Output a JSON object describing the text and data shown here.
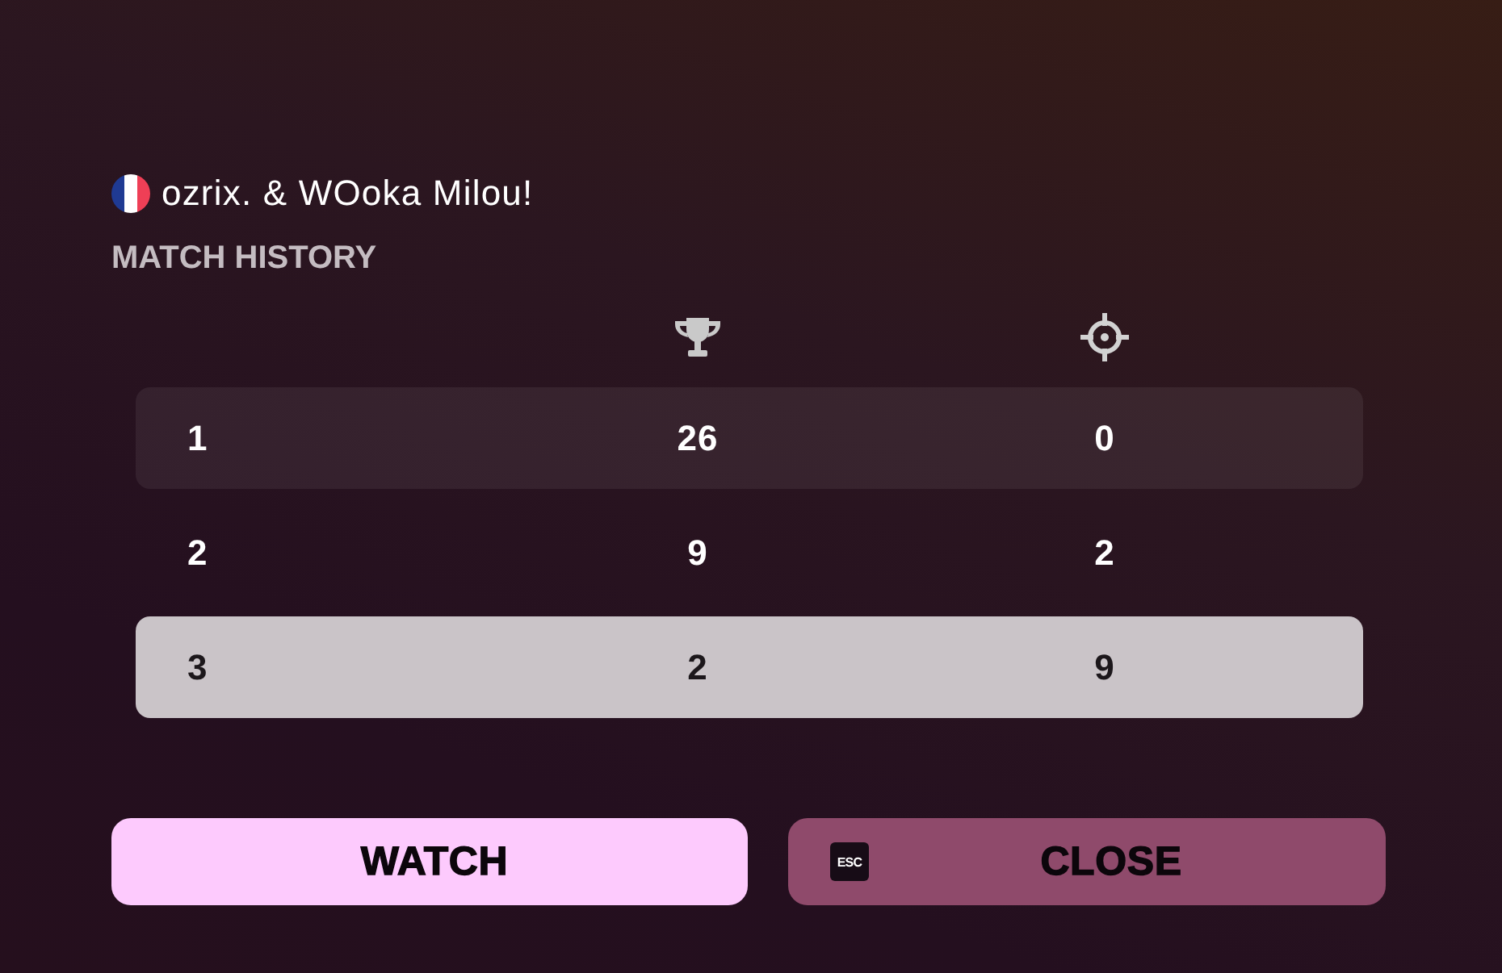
{
  "player": {
    "name": "ozrix. & WOoka Milou!"
  },
  "section_title": "MATCH HISTORY",
  "table": {
    "rows": [
      {
        "cells": [
          "1",
          "26",
          "0"
        ],
        "selected": false
      },
      {
        "cells": [
          "2",
          "9",
          "2"
        ],
        "selected": false
      },
      {
        "cells": [
          "3",
          "2",
          "9"
        ],
        "selected": true
      }
    ]
  },
  "buttons": [
    {
      "kind": "primary",
      "label": "WATCH"
    },
    {
      "kind": "secondary",
      "label": "CLOSE",
      "key_hint": "ESC"
    }
  ]
}
